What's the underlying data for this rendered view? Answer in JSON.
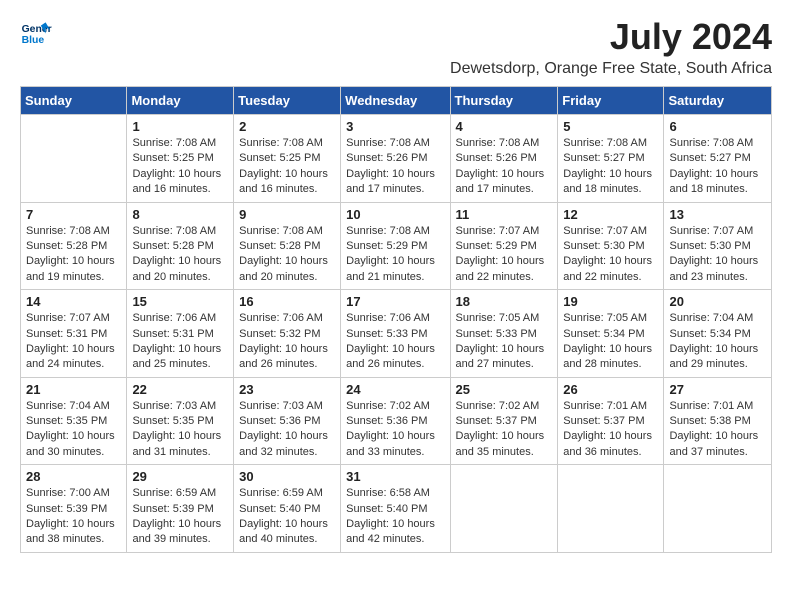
{
  "logo": {
    "line1": "General",
    "line2": "Blue"
  },
  "title": "July 2024",
  "subtitle": "Dewetsdorp, Orange Free State, South Africa",
  "days_of_week": [
    "Sunday",
    "Monday",
    "Tuesday",
    "Wednesday",
    "Thursday",
    "Friday",
    "Saturday"
  ],
  "weeks": [
    [
      {
        "day": "",
        "info": ""
      },
      {
        "day": "1",
        "info": "Sunrise: 7:08 AM\nSunset: 5:25 PM\nDaylight: 10 hours\nand 16 minutes."
      },
      {
        "day": "2",
        "info": "Sunrise: 7:08 AM\nSunset: 5:25 PM\nDaylight: 10 hours\nand 16 minutes."
      },
      {
        "day": "3",
        "info": "Sunrise: 7:08 AM\nSunset: 5:26 PM\nDaylight: 10 hours\nand 17 minutes."
      },
      {
        "day": "4",
        "info": "Sunrise: 7:08 AM\nSunset: 5:26 PM\nDaylight: 10 hours\nand 17 minutes."
      },
      {
        "day": "5",
        "info": "Sunrise: 7:08 AM\nSunset: 5:27 PM\nDaylight: 10 hours\nand 18 minutes."
      },
      {
        "day": "6",
        "info": "Sunrise: 7:08 AM\nSunset: 5:27 PM\nDaylight: 10 hours\nand 18 minutes."
      }
    ],
    [
      {
        "day": "7",
        "info": "Sunrise: 7:08 AM\nSunset: 5:28 PM\nDaylight: 10 hours\nand 19 minutes."
      },
      {
        "day": "8",
        "info": "Sunrise: 7:08 AM\nSunset: 5:28 PM\nDaylight: 10 hours\nand 20 minutes."
      },
      {
        "day": "9",
        "info": "Sunrise: 7:08 AM\nSunset: 5:28 PM\nDaylight: 10 hours\nand 20 minutes."
      },
      {
        "day": "10",
        "info": "Sunrise: 7:08 AM\nSunset: 5:29 PM\nDaylight: 10 hours\nand 21 minutes."
      },
      {
        "day": "11",
        "info": "Sunrise: 7:07 AM\nSunset: 5:29 PM\nDaylight: 10 hours\nand 22 minutes."
      },
      {
        "day": "12",
        "info": "Sunrise: 7:07 AM\nSunset: 5:30 PM\nDaylight: 10 hours\nand 22 minutes."
      },
      {
        "day": "13",
        "info": "Sunrise: 7:07 AM\nSunset: 5:30 PM\nDaylight: 10 hours\nand 23 minutes."
      }
    ],
    [
      {
        "day": "14",
        "info": "Sunrise: 7:07 AM\nSunset: 5:31 PM\nDaylight: 10 hours\nand 24 minutes."
      },
      {
        "day": "15",
        "info": "Sunrise: 7:06 AM\nSunset: 5:31 PM\nDaylight: 10 hours\nand 25 minutes."
      },
      {
        "day": "16",
        "info": "Sunrise: 7:06 AM\nSunset: 5:32 PM\nDaylight: 10 hours\nand 26 minutes."
      },
      {
        "day": "17",
        "info": "Sunrise: 7:06 AM\nSunset: 5:33 PM\nDaylight: 10 hours\nand 26 minutes."
      },
      {
        "day": "18",
        "info": "Sunrise: 7:05 AM\nSunset: 5:33 PM\nDaylight: 10 hours\nand 27 minutes."
      },
      {
        "day": "19",
        "info": "Sunrise: 7:05 AM\nSunset: 5:34 PM\nDaylight: 10 hours\nand 28 minutes."
      },
      {
        "day": "20",
        "info": "Sunrise: 7:04 AM\nSunset: 5:34 PM\nDaylight: 10 hours\nand 29 minutes."
      }
    ],
    [
      {
        "day": "21",
        "info": "Sunrise: 7:04 AM\nSunset: 5:35 PM\nDaylight: 10 hours\nand 30 minutes."
      },
      {
        "day": "22",
        "info": "Sunrise: 7:03 AM\nSunset: 5:35 PM\nDaylight: 10 hours\nand 31 minutes."
      },
      {
        "day": "23",
        "info": "Sunrise: 7:03 AM\nSunset: 5:36 PM\nDaylight: 10 hours\nand 32 minutes."
      },
      {
        "day": "24",
        "info": "Sunrise: 7:02 AM\nSunset: 5:36 PM\nDaylight: 10 hours\nand 33 minutes."
      },
      {
        "day": "25",
        "info": "Sunrise: 7:02 AM\nSunset: 5:37 PM\nDaylight: 10 hours\nand 35 minutes."
      },
      {
        "day": "26",
        "info": "Sunrise: 7:01 AM\nSunset: 5:37 PM\nDaylight: 10 hours\nand 36 minutes."
      },
      {
        "day": "27",
        "info": "Sunrise: 7:01 AM\nSunset: 5:38 PM\nDaylight: 10 hours\nand 37 minutes."
      }
    ],
    [
      {
        "day": "28",
        "info": "Sunrise: 7:00 AM\nSunset: 5:39 PM\nDaylight: 10 hours\nand 38 minutes."
      },
      {
        "day": "29",
        "info": "Sunrise: 6:59 AM\nSunset: 5:39 PM\nDaylight: 10 hours\nand 39 minutes."
      },
      {
        "day": "30",
        "info": "Sunrise: 6:59 AM\nSunset: 5:40 PM\nDaylight: 10 hours\nand 40 minutes."
      },
      {
        "day": "31",
        "info": "Sunrise: 6:58 AM\nSunset: 5:40 PM\nDaylight: 10 hours\nand 42 minutes."
      },
      {
        "day": "",
        "info": ""
      },
      {
        "day": "",
        "info": ""
      },
      {
        "day": "",
        "info": ""
      }
    ]
  ]
}
